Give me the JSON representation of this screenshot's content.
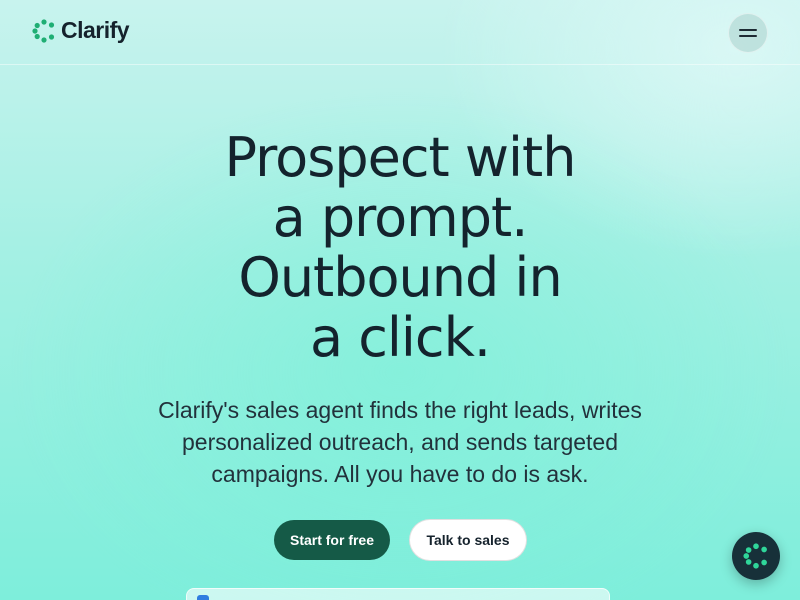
{
  "header": {
    "brand_name": "Clarify",
    "menu_icon": "hamburger-icon"
  },
  "hero": {
    "title_lines": [
      "Prospect with",
      "a prompt.",
      "Outbound in",
      "a click."
    ],
    "subtitle": "Clarify's sales agent finds the right leads, writes personalized outreach, and sends targeted campaigns. All you have to do is ask.",
    "primary_cta": "Start for free",
    "secondary_cta": "Talk to sales"
  },
  "chat": {
    "icon": "clarify-logo-icon"
  },
  "colors": {
    "brand_green": "#1fae74",
    "primary_button": "#155a47",
    "text_dark": "#14232d",
    "chat_bg": "#173039"
  }
}
